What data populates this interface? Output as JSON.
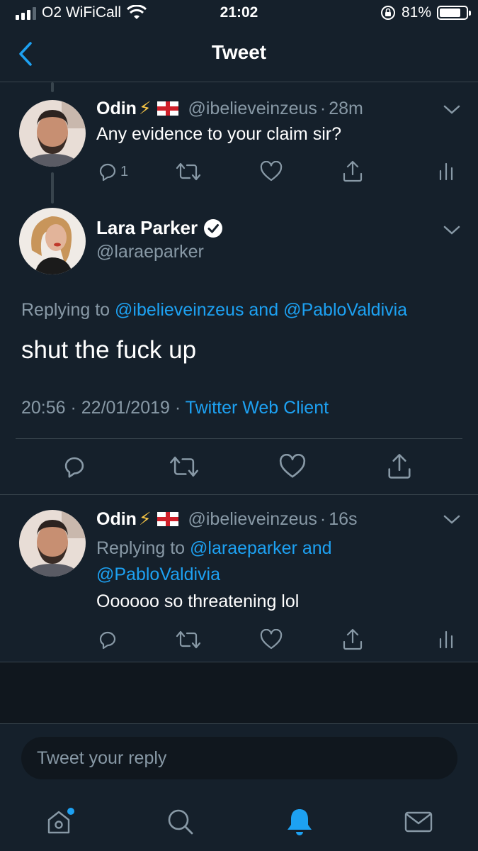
{
  "status_bar": {
    "carrier": "O2 WiFiCall",
    "time": "21:02",
    "battery_percent": "81%",
    "battery_level": 0.81
  },
  "nav": {
    "title": "Tweet"
  },
  "tweet1": {
    "name": "Odin",
    "emoji": "⚡",
    "handle": "@ibelieveinzeus",
    "time": "28m",
    "text": "Any evidence to your claim sir?",
    "reply_count": "1"
  },
  "main_tweet": {
    "name": "Lara Parker",
    "handle": "@laraeparker",
    "replying_prefix": "Replying to",
    "replying_user1": "@ibelieveinzeus",
    "replying_and": "and",
    "replying_user2": "@PabloValdivia",
    "text": "shut the fuck up",
    "timestamp": "20:56 · 22/01/2019 ·",
    "client": "Twitter Web Client"
  },
  "tweet3": {
    "name": "Odin",
    "emoji": "⚡",
    "handle": "@ibelieveinzeus",
    "time": "16s",
    "replying_prefix": "Replying to",
    "replying_user1": "@laraeparker",
    "replying_and": "and",
    "replying_user2": "@PabloValdivia",
    "text": "Oooooo so threatening lol"
  },
  "reply_bar": {
    "placeholder": "Tweet your reply"
  },
  "colors": {
    "background": "#15202b",
    "accent": "#1da1f2",
    "muted": "#8899a6",
    "divider": "#38444d"
  },
  "icons": [
    "back-chevron-icon",
    "reply-icon",
    "retweet-icon",
    "like-icon",
    "share-icon",
    "analytics-icon",
    "verified-icon",
    "home-icon",
    "search-icon",
    "notifications-icon",
    "messages-icon"
  ]
}
